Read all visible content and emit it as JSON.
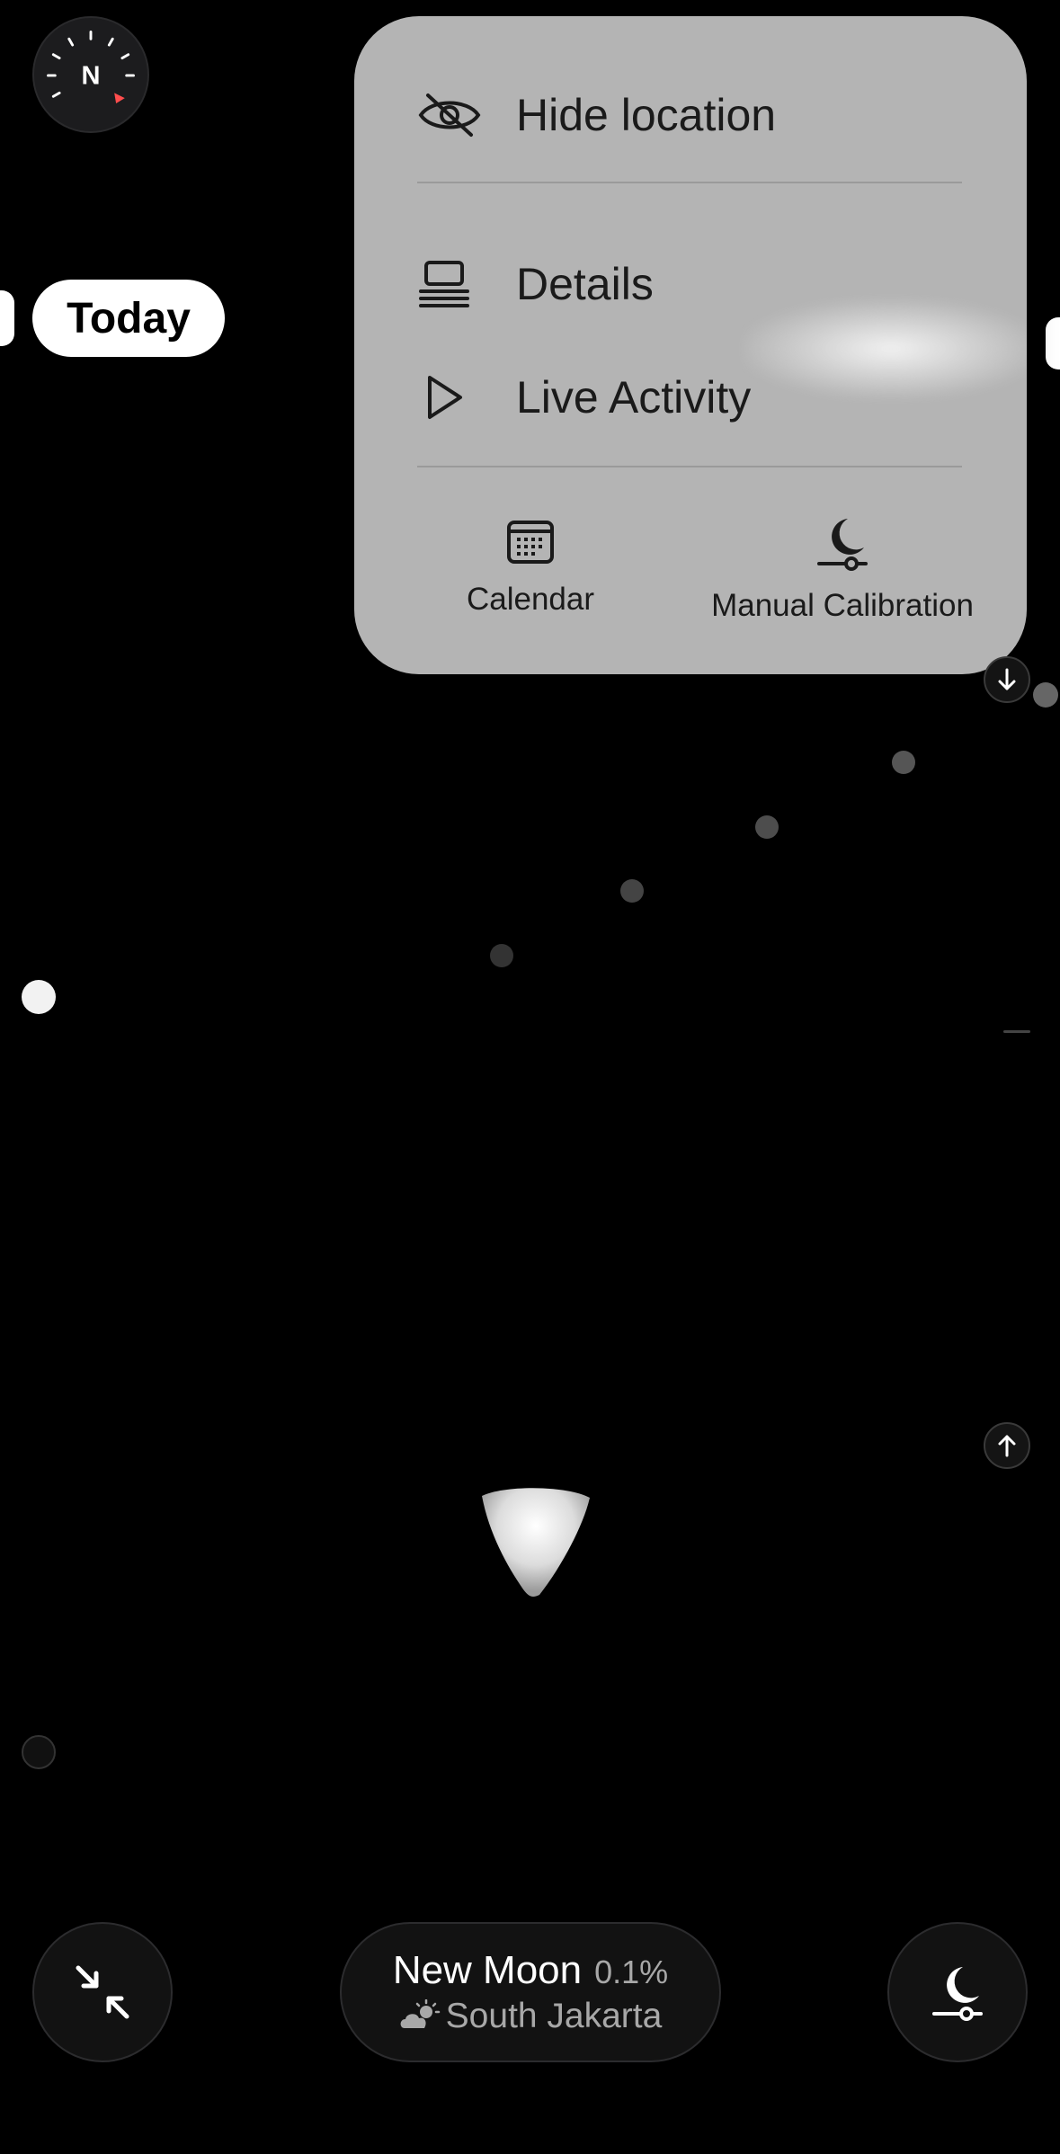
{
  "compass": {
    "north_label": "N"
  },
  "today_button": {
    "label": "Today"
  },
  "menu": {
    "items": [
      {
        "label": "Hide location",
        "icon": "eye-slash-icon"
      },
      {
        "label": "Details",
        "icon": "list-details-icon"
      },
      {
        "label": "Live Activity",
        "icon": "play-icon"
      }
    ],
    "bottom_items": [
      {
        "label": "Calendar",
        "icon": "calendar-icon"
      },
      {
        "label": "Manual Calibration",
        "icon": "moon-slider-icon"
      }
    ]
  },
  "status": {
    "phase_name": "New Moon",
    "illumination": "0.1%",
    "weather_icon": "partly-cloudy-icon",
    "location": "South Jakarta"
  },
  "bottom_controls": {
    "left_icon": "collapse-arrows-icon",
    "right_icon": "moon-slider-icon"
  },
  "side_controls": {
    "top_icon": "arrow-down-icon",
    "bottom_icon": "arrow-up-icon"
  },
  "colors": {
    "background": "#000000",
    "menu_background": "#b4b4b4",
    "compass_pointer": "#ff4d4d",
    "secondary_text": "#a8a8a8"
  }
}
